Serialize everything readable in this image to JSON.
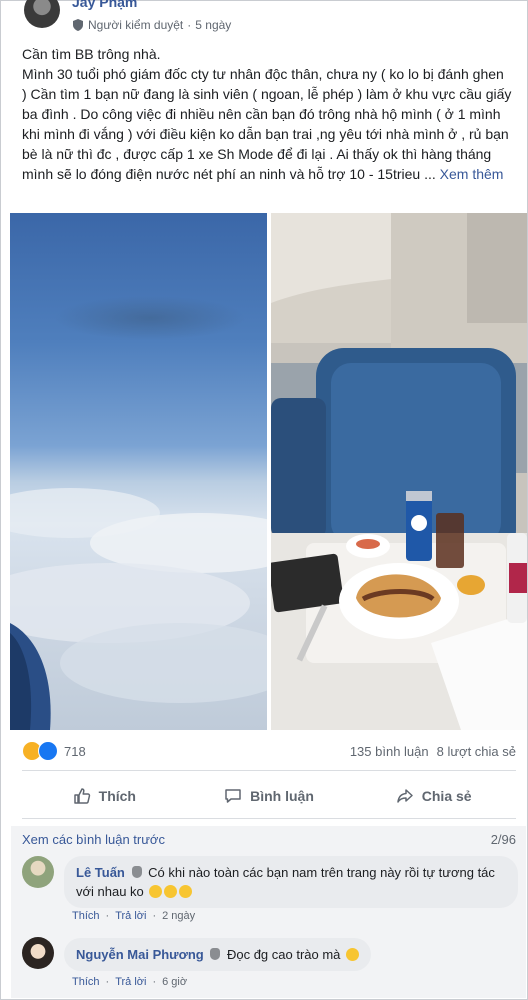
{
  "post": {
    "author": "Jay Phạm",
    "moderator_label": "Người kiểm duyệt",
    "time": "5 ngày",
    "separator": "·",
    "text_lines": [
      "Cần tìm BB trông nhà.",
      "Mình 30 tuổi phó giám đốc cty tư nhân độc thân, chưa ny ( ko lo bị đánh ghen ) Cần tìm 1 bạn nữ đang là sinh viên ( ngoan, lễ phép ) làm ở khu vực cầu giấy ba đình . Do công việc đi nhiều nên cần bạn đó trông nhà hộ mình ( ở 1 mình khi mình đi vắng ) với điều kiện ko dẫn bạn trai ,ng yêu tới nhà mình ở , rủ bạn bè là nữ thì đc , được cấp 1 xe Sh Mode để đi lại . Ai thấy ok thì hàng tháng mình sẽ lo đóng điện nước nét phí an ninh và hỗ trợ 10 - 15trieu ..."
    ],
    "see_more": "Xem thêm",
    "images": [
      "airplane-window-sky-photo",
      "airplane-cabin-meal-photo"
    ]
  },
  "reactions": {
    "count": "718",
    "comments": "135 bình luận",
    "shares": "8 lượt chia sẻ"
  },
  "actions": {
    "like": "Thích",
    "comment": "Bình luận",
    "share": "Chia sẻ"
  },
  "comments_section": {
    "view_previous": "Xem các bình luận trước",
    "counter": "2/96",
    "items": [
      {
        "name": "Lê Tuấn",
        "text": "Có khi nào toàn các bạn nam trên trang này rồi tự tương tác với nhau ko",
        "like": "Thích",
        "reply": "Trả lời",
        "time": "2 ngày"
      },
      {
        "name": "Nguyễn Mai Phương",
        "text": "Đọc đg cao trào mà",
        "like": "Thích",
        "reply": "Trả lời",
        "time": "6 giờ"
      }
    ]
  },
  "colors": {
    "link": "#385898",
    "muted": "#606770",
    "like_blue": "#1877f2",
    "haha_yellow": "#f7b125"
  }
}
